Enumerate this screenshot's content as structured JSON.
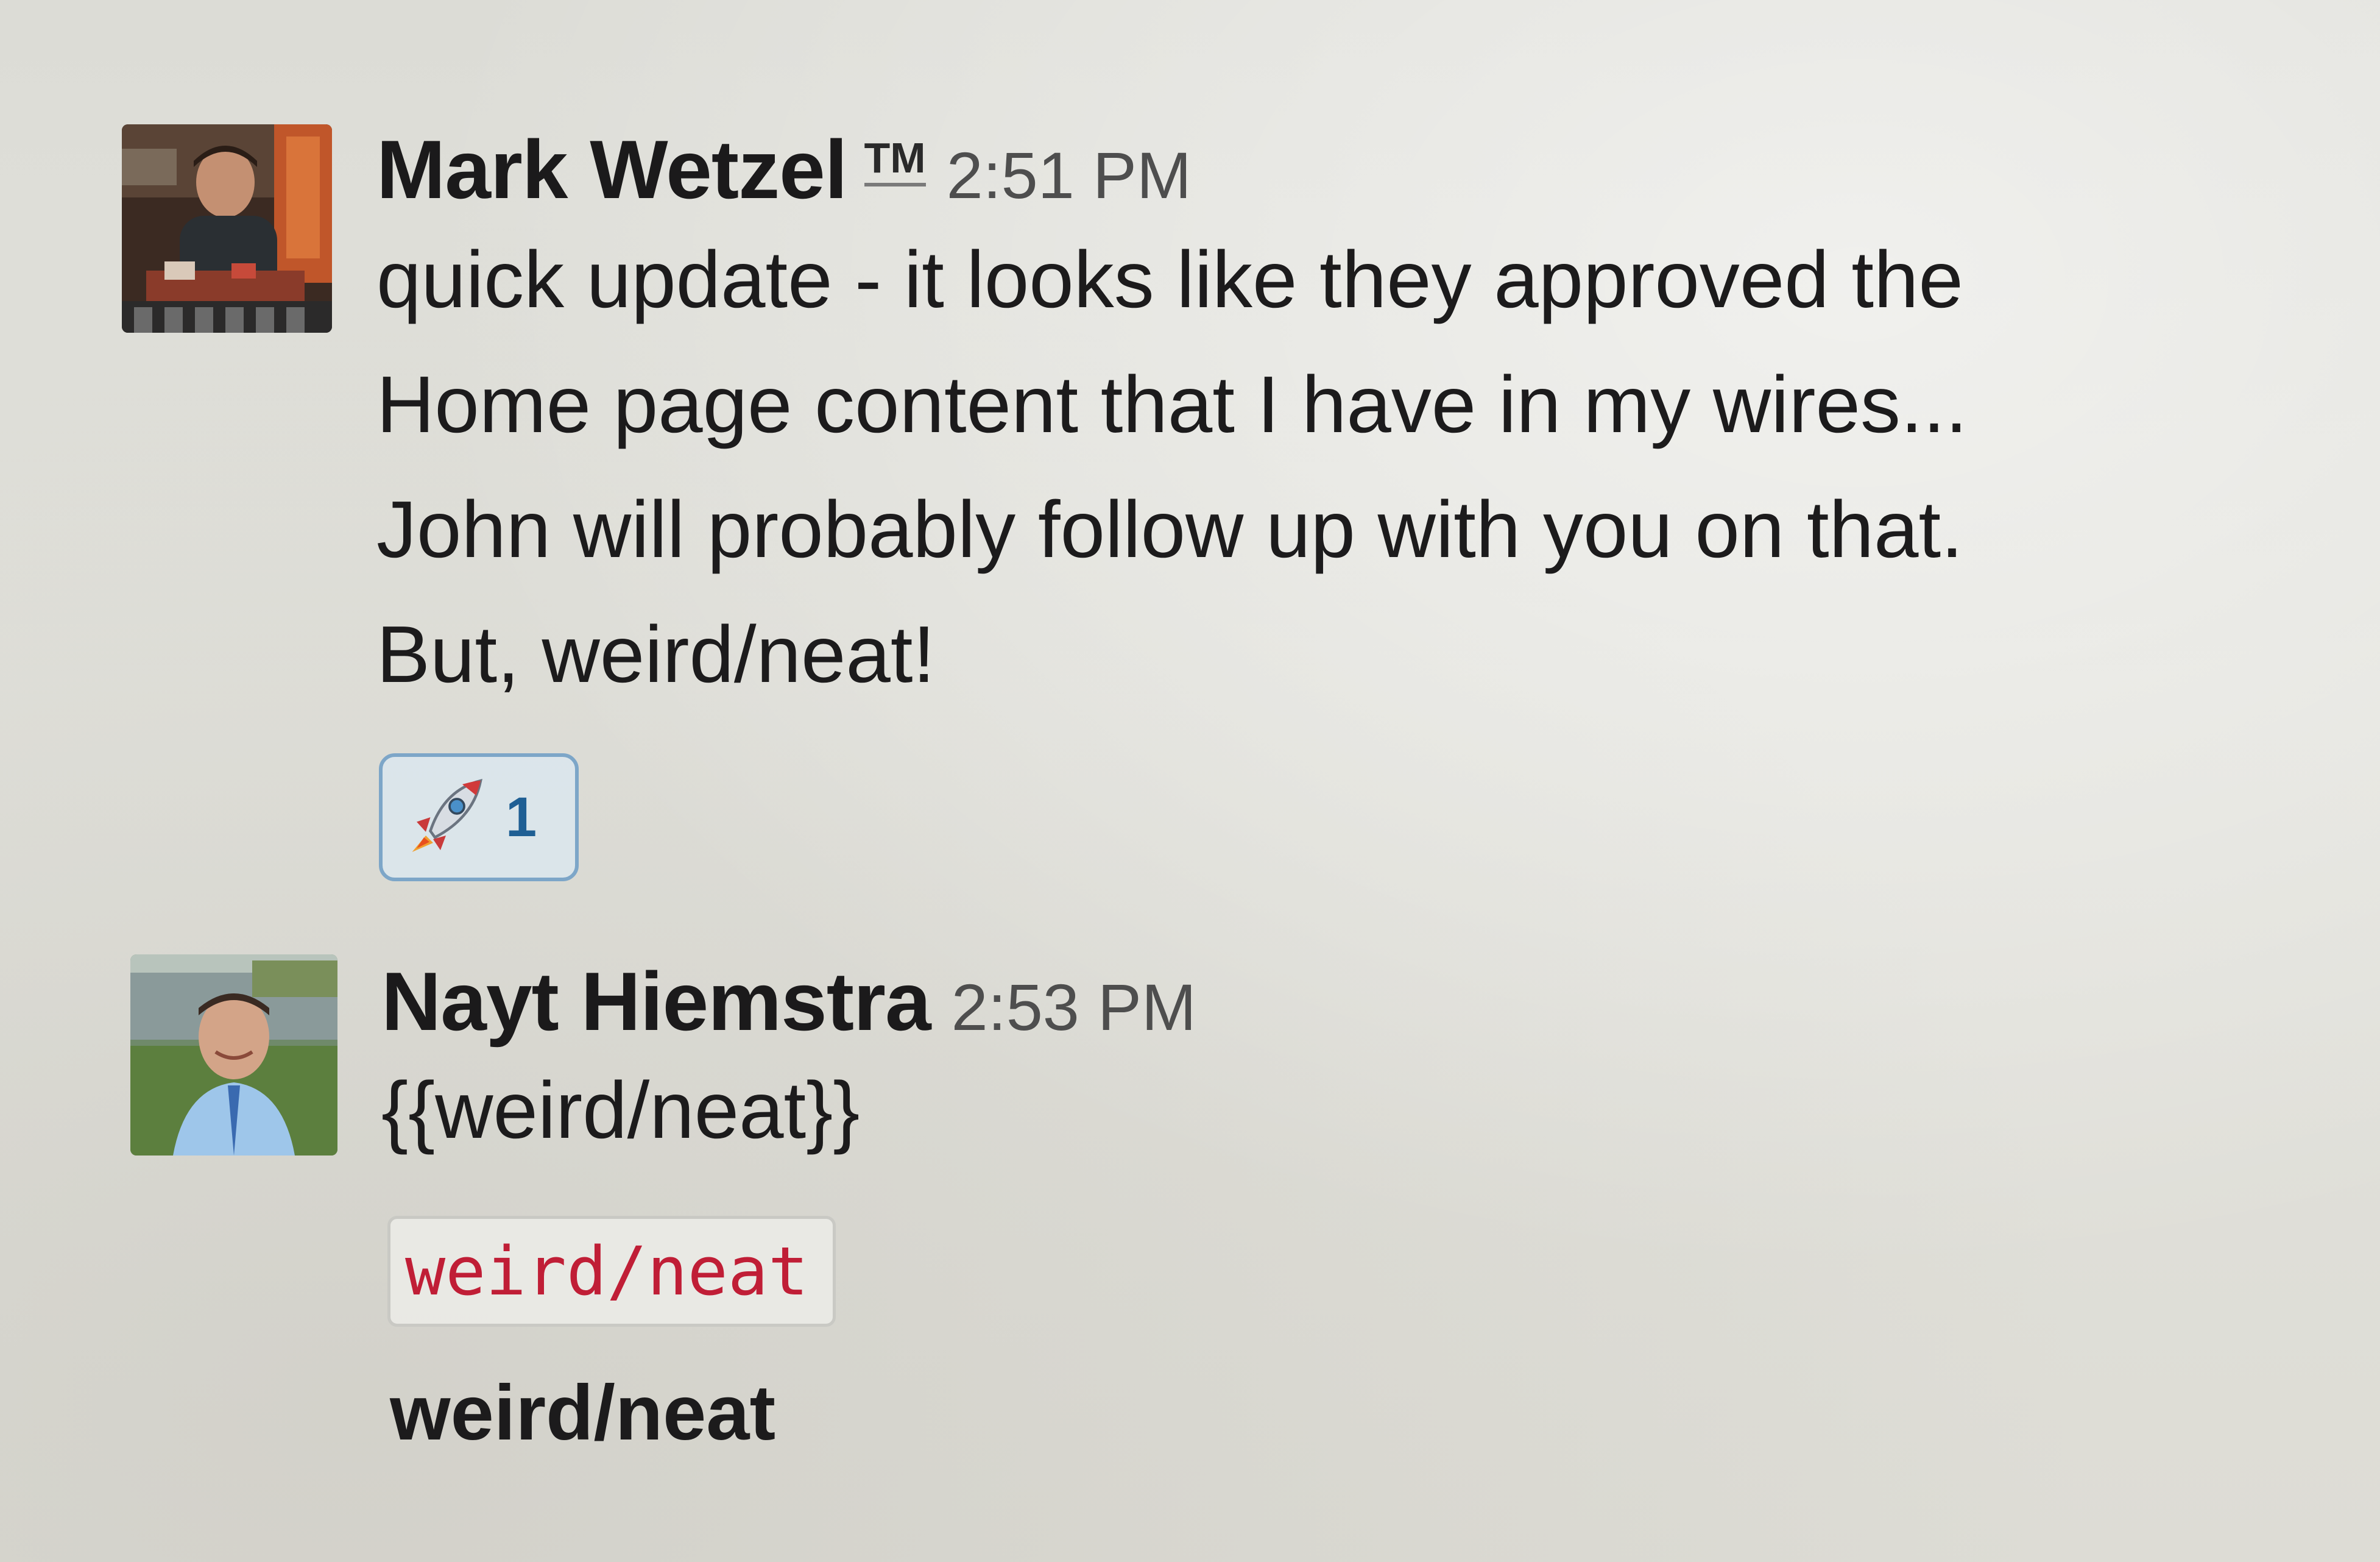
{
  "messages": [
    {
      "sender": "Mark Wetzel",
      "badge": "TM",
      "time": "2:51 PM",
      "lines": [
        "quick update - it looks like they approved the",
        "Home page content that I have in my wires...",
        "John will probably follow up with you on that.",
        "But, weird/neat!"
      ],
      "reaction": {
        "icon": "rocket-icon",
        "count": "1"
      }
    },
    {
      "sender": "Nayt Hiemstra",
      "time": "2:53 PM",
      "text": "{{weird/neat}}",
      "code": "weird/neat",
      "bold": "weird/neat"
    }
  ],
  "colors": {
    "reaction_border": "#7da6c8",
    "reaction_count": "#1f5f94",
    "code_text": "#c01e36"
  }
}
